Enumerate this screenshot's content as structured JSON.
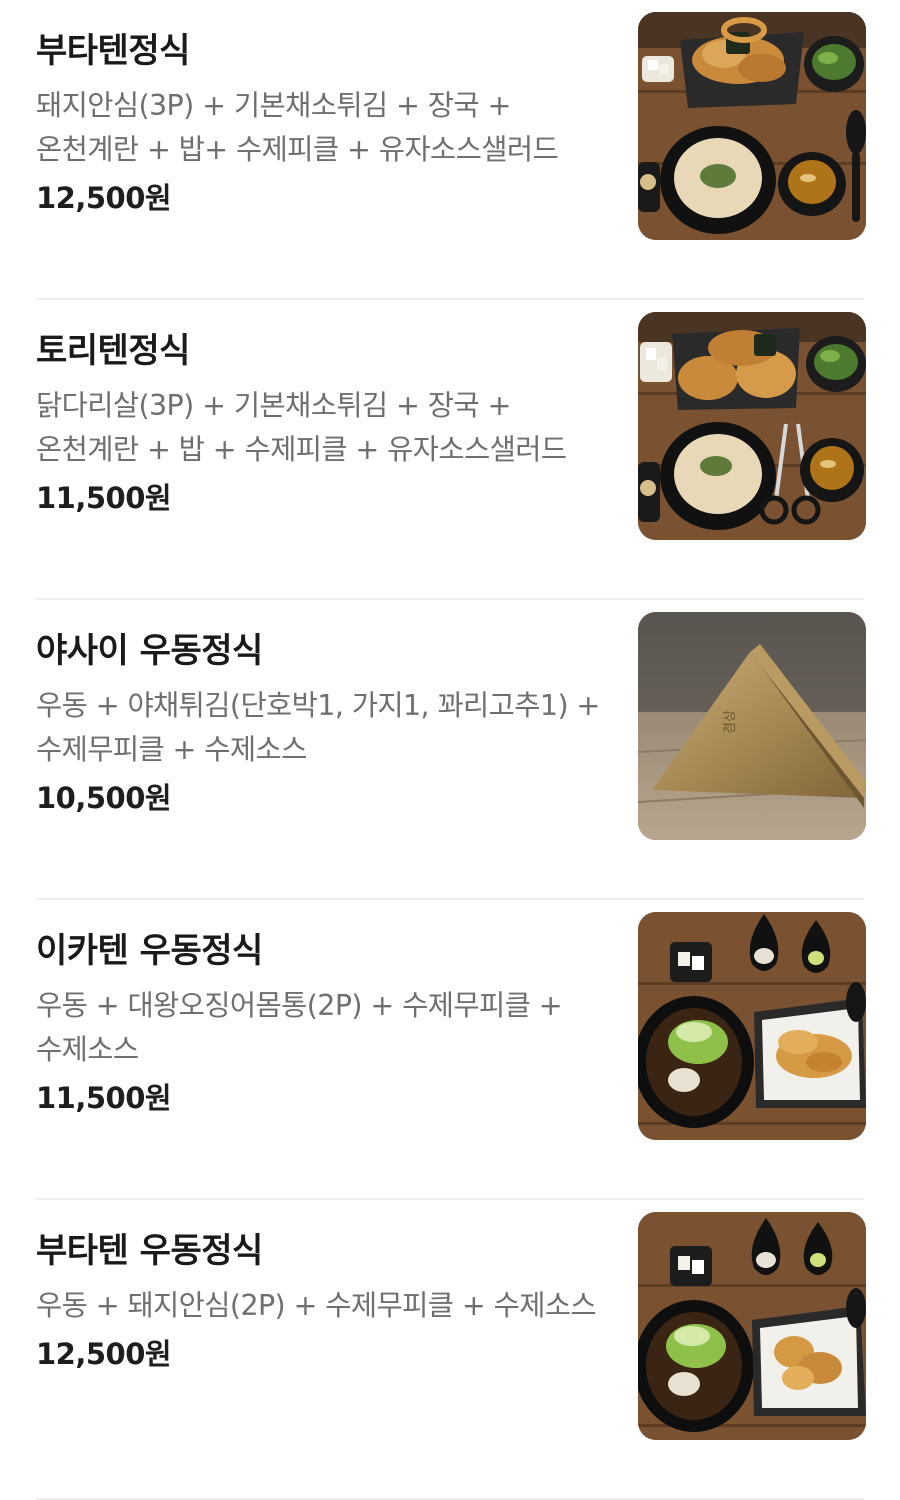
{
  "menu": {
    "items": [
      {
        "name": "부타텐정식",
        "description": "돼지안심(3P) + 기본채소튀김 + 장국 + 온천계란 + 밥+ 수제피클 + 유자소스샐러드",
        "price": "12,500원",
        "photo_icon": "pork-tempura-set-photo"
      },
      {
        "name": "토리텐정식",
        "description": "닭다리살(3P) + 기본채소튀김 + 장국 + 온천계란 + 밥 + 수제피클 + 유자소스샐러드",
        "price": "11,500원",
        "photo_icon": "chicken-tempura-set-photo"
      },
      {
        "name": "야사이 우동정식",
        "description": "우동 + 야채튀김(단호박1, 가지1, 꽈리고추1) + 수제무피클 + 수제소스",
        "price": "10,500원",
        "photo_icon": "napkin-holder-photo",
        "photo_text": "겸상"
      },
      {
        "name": "이카텐 우동정식",
        "description": "우동 + 대왕오징어몸통(2P) + 수제무피클 + 수제소스",
        "price": "11,500원",
        "photo_icon": "squid-tempura-udon-photo"
      },
      {
        "name": "부타텐 우동정식",
        "description": "우동 + 돼지안심(2P) + 수제무피클 + 수제소스",
        "price": "12,500원",
        "photo_icon": "pork-tempura-udon-photo"
      }
    ]
  },
  "colors": {
    "name": "#1a1a1a",
    "description": "#6f6f6f",
    "price": "#1e1e1e",
    "divider": "#eeeeee",
    "wood_table": "#7a5231"
  }
}
